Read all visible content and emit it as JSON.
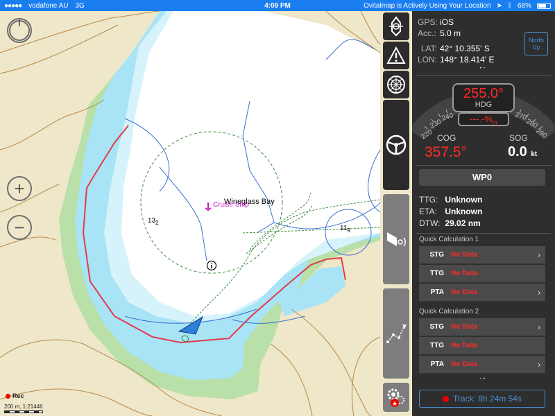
{
  "status_bar": {
    "carrier": "vodafone AU",
    "network": "3G",
    "time": "4:09 PM",
    "location_notice": "Ovitalmap is Actively Using Your Location",
    "battery": "68%",
    "battery_level": 0.68,
    "bg_color": "#1a7ef0"
  },
  "map": {
    "place_label": "Wineglass Bay",
    "poi_label": "Cruise Ship",
    "depth_1": "13",
    "depth_1_sub": "2",
    "depth_2": "11",
    "depth_2_sub": "9",
    "info_icon": "info-icon",
    "rec_label": "Rec",
    "scale_label": "200 m, 1:21446",
    "zoom_in_icon": "+",
    "zoom_out_icon": "−",
    "colors": {
      "land": "#efe7c9",
      "shallow_water": "#a8e4f5",
      "deep_water": "#ffffff",
      "green_shore": "#b8e0a8",
      "red_boundary": "#e33a4a",
      "contour": "#b68a4a",
      "depth_line": "#3b6fd0",
      "track": "#3a8a3a"
    }
  },
  "tools": [
    {
      "name": "anchor-tool-icon"
    },
    {
      "name": "warning-icon"
    },
    {
      "name": "compass-icon"
    },
    {
      "name": "steering-wheel-icon"
    },
    {
      "name": "sound-icon"
    },
    {
      "name": "route-icon"
    },
    {
      "name": "settings-gears-icon"
    }
  ],
  "panel": {
    "gps_label": "GPS:",
    "gps_value": "iOS",
    "acc_label": "Acc.:",
    "acc_value": "5.0 m",
    "lat_label": "LAT:",
    "lat_value": "42° 10.355' S",
    "lon_label": "LON:",
    "lon_value": "148° 18.414' E",
    "north_up": "North Up",
    "heading": "255.0°",
    "heading_label": "HDG",
    "xte": "---.-%",
    "xte_unit": "m",
    "compass_ticks": [
      "220",
      "230",
      "240",
      "270",
      "280",
      "290"
    ],
    "cog_label": "COG",
    "cog_value": "357.5°",
    "sog_label": "SOG",
    "sog_value": "0.0",
    "sog_unit": "kt",
    "waypoint": "WP0",
    "ttg_label": "TTG:",
    "ttg_value": "Unknown",
    "eta_label": "ETA:",
    "eta_value": "Unknown",
    "dtw_label": "DTW:",
    "dtw_value": "29.02 nm",
    "quick_calc_1": {
      "title": "Quick Calculation 1",
      "rows": [
        {
          "key": "STG",
          "value": "No Data",
          "chevron": true
        },
        {
          "key": "TTG",
          "value": "No Data",
          "chevron": false
        },
        {
          "key": "PTA",
          "value": "No Data",
          "chevron": true
        }
      ]
    },
    "quick_calc_2": {
      "title": "Quick Calculation 2",
      "rows": [
        {
          "key": "STG",
          "value": "No Data",
          "chevron": true
        },
        {
          "key": "TTG",
          "value": "No Data",
          "chevron": false
        },
        {
          "key": "PTA",
          "value": "No Data",
          "chevron": true
        }
      ]
    },
    "track_label": "Track: 8h 24m 54s",
    "pager_dots": "• •"
  }
}
